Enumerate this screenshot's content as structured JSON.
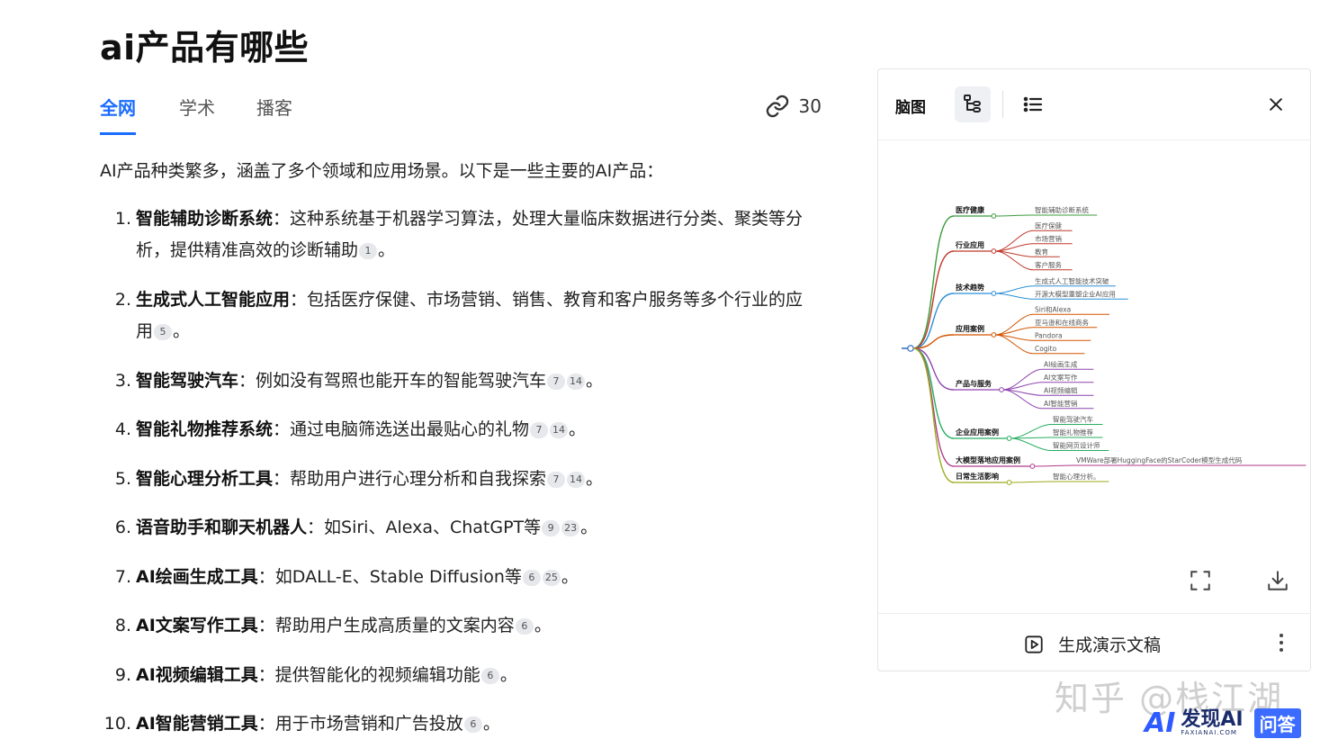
{
  "page": {
    "title": "ai产品有哪些",
    "tabs": [
      "全网",
      "学术",
      "播客"
    ],
    "source_count": "30",
    "intro": "AI产品种类繁多，涵盖了多个领域和应用场景。以下是一些主要的AI产品："
  },
  "items": [
    {
      "num": "1.",
      "title": "智能辅助诊断系统",
      "sep": "：",
      "text": "这种系统基于机器学习算法，处理大量临床数据进行分类、聚类等分析，提供精准高效的诊断辅助",
      "refs": [
        "1"
      ],
      "end": "。"
    },
    {
      "num": "2.",
      "title": "生成式人工智能应用",
      "sep": "：",
      "text": "包括医疗保健、市场营销、销售、教育和客户服务等多个行业的应用",
      "refs": [
        "5"
      ],
      "end": "。"
    },
    {
      "num": "3.",
      "title": "智能驾驶汽车",
      "sep": "：",
      "text": "例如没有驾照也能开车的智能驾驶汽车",
      "refs": [
        "7",
        "14"
      ],
      "end": "。"
    },
    {
      "num": "4.",
      "title": "智能礼物推荐系统",
      "sep": "：",
      "text": "通过电脑筛选送出最贴心的礼物",
      "refs": [
        "7",
        "14"
      ],
      "end": "。"
    },
    {
      "num": "5.",
      "title": "智能心理分析工具",
      "sep": "：",
      "text": "帮助用户进行心理分析和自我探索",
      "refs": [
        "7",
        "14"
      ],
      "end": "。"
    },
    {
      "num": "6.",
      "title": "语音助手和聊天机器人",
      "sep": "：",
      "text": "如Siri、Alexa、ChatGPT等",
      "refs": [
        "9",
        "23"
      ],
      "end": "。"
    },
    {
      "num": "7.",
      "title": "AI绘画生成工具",
      "sep": "：",
      "text": "如DALL-E、Stable Diffusion等",
      "refs": [
        "6",
        "25"
      ],
      "end": "。"
    },
    {
      "num": "8.",
      "title": "AI文案写作工具",
      "sep": "：",
      "text": "帮助用户生成高质量的文案内容",
      "refs": [
        "6"
      ],
      "end": "。"
    },
    {
      "num": "9.",
      "title": "AI视频编辑工具",
      "sep": "：",
      "text": "提供智能化的视频编辑功能",
      "refs": [
        "6"
      ],
      "end": "。"
    },
    {
      "num": "10.",
      "title": "AI智能营销工具",
      "sep": "：",
      "text": "用于市场营销和广告投放",
      "refs": [
        "6"
      ],
      "end": "。"
    }
  ],
  "panel": {
    "title": "脑图",
    "mindmap_icon": "tree-branch-icon",
    "list_icon": "bulleted-list-icon",
    "close_icon": "close-icon",
    "fullscreen_icon": "fullscreen-icon",
    "download_icon": "download-icon",
    "generate_label": "生成演示文稿",
    "generate_icon": "play-icon",
    "more_icon": "more-vertical-icon"
  },
  "mindmap": [
    {
      "label": "医疗健康",
      "color": "#3b9b3b",
      "children": [
        "智能辅助诊断系统"
      ]
    },
    {
      "label": "行业应用",
      "color": "#c0392b",
      "children": [
        "医疗保健",
        "市场营销",
        "教育",
        "客户服务"
      ]
    },
    {
      "label": "技术趋势",
      "color": "#2a8fd6",
      "children": [
        "生成式人工智能技术突破",
        "开源大模型重塑企业AI应用"
      ]
    },
    {
      "label": "应用案例",
      "color": "#d35400",
      "children": [
        "Siri和Alexa",
        "亚马逊和在线商务",
        "Pandora",
        "Cogito"
      ]
    },
    {
      "label": "产品与服务",
      "color": "#8e44ad",
      "children": [
        "AI绘画生成",
        "AI文案写作",
        "AI视频编辑",
        "AI智能营销"
      ]
    },
    {
      "label": "企业应用案例",
      "color": "#27ae60",
      "children": [
        "智能驾驶汽车",
        "智能礼物推荐",
        "智能网页设计师"
      ]
    },
    {
      "label": "大模型落地应用案例",
      "color": "#b03a8a",
      "children": [
        "VMWare部署HuggingFace的StarCoder模型生成代码"
      ]
    },
    {
      "label": "日常生活影响",
      "color": "#9aaa1a",
      "children": [
        "智能心理分析。"
      ]
    }
  ],
  "watermark": "知乎 @栈江湖",
  "logo": {
    "mark": "AI",
    "name": "发现AI",
    "domain": "FAXIANAI.COM",
    "badge": "问答"
  }
}
